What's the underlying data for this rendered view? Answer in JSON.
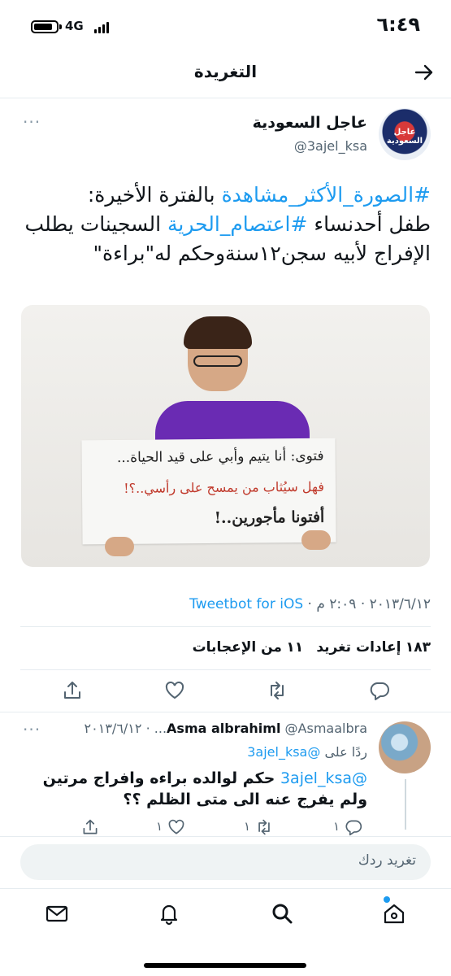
{
  "status_bar": {
    "network": "4G",
    "time": "٦:٤٩"
  },
  "header": {
    "title": "التغريدة"
  },
  "tweet": {
    "author_name": "عاجل السعودية",
    "author_handle": "@3ajel_ksa",
    "avatar_text": "عاجل السعودية",
    "text_parts": {
      "hashtag1": "#الصورة_الأكثر_مشاهدة",
      "part1": " بالفترة الأخيرة:",
      "part2": "طفل أحدنساء ",
      "hashtag2": "#اعتصام_الحرية",
      "part3": " السجينات يطلب الإفراج لأبيه سجن١٢سنةوحكم له\"براءة\""
    },
    "image_sign": {
      "line1": "فتوى: أنا يتيم وأبي على قيد الحياة...",
      "line2": "فهل سيُثاب من يمسح على رأسي..؟!",
      "line3": "أفتونا مأجورين..!"
    },
    "meta": {
      "date": "٢٠١٣/٦/١٢",
      "time": "٢:٠٩ م",
      "separator": "·",
      "source": "Tweetbot for iOS"
    },
    "stats": {
      "retweets_count": "١٨٣",
      "retweets_label": "إعادات تغريد",
      "likes_count": "١١",
      "likes_label": "من الإعجابات"
    }
  },
  "reply": {
    "name": "Asma albrahiml",
    "handle": "@Asmaalbra...",
    "date": "٢٠١٣/٦/١٢",
    "replying_label": "ردًا على",
    "replying_handle": "@3ajel_ksa",
    "mention": "@3ajel_ksa",
    "text": " حكم لوالده براءه وافراج مرتين ولم يفرج عنه الى متى الظلم ؟؟",
    "counts": {
      "replies": "١",
      "retweets": "١",
      "likes": "١"
    }
  },
  "compose": {
    "placeholder": "تغريد ردك"
  },
  "icons": {
    "back": "arrow-right-icon",
    "more": "more-icon",
    "reply": "comment-icon",
    "retweet": "retweet-icon",
    "like": "heart-icon",
    "share": "share-icon",
    "home": "home-icon",
    "search": "search-icon",
    "notifications": "bell-icon",
    "messages": "mail-icon"
  },
  "colors": {
    "accent": "#1d9bf0",
    "secondary_text": "#536471",
    "shirt": "#6a2bb3"
  }
}
